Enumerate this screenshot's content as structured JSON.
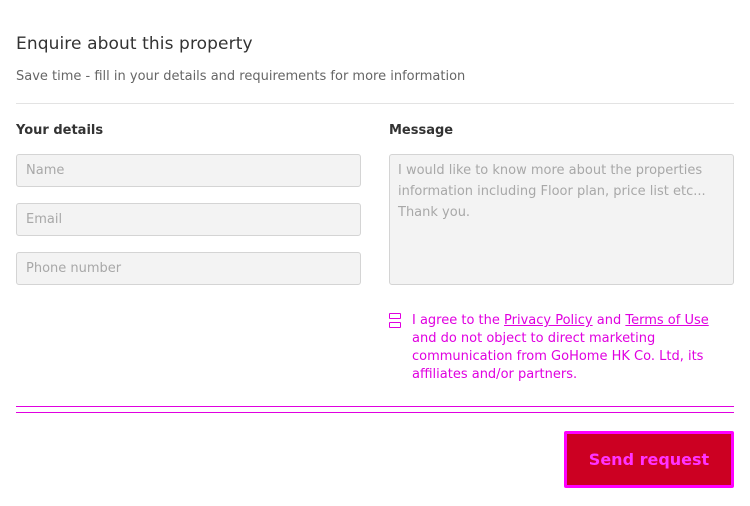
{
  "header": {
    "title": "Enquire about this property",
    "subtitle": "Save time - fill in your details and requirements for more information"
  },
  "details": {
    "label": "Your details",
    "name_placeholder": "Name",
    "email_placeholder": "Email",
    "phone_placeholder": "Phone number"
  },
  "message": {
    "label": "Message",
    "placeholder": "I would like to know more about the properties information including Floor plan, price list etc... Thank you."
  },
  "consent": {
    "text_before": "I agree to the ",
    "privacy_link": "Privacy Policy",
    "text_and": " and ",
    "terms_link": "Terms of Use",
    "text_after": " and do not object to direct marketing communication from GoHome HK Co. Ltd, its affiliates and/or partners."
  },
  "actions": {
    "send_label": "Send request"
  },
  "colors": {
    "button_bg": "#cc0022",
    "highlight": "#e000e0"
  }
}
